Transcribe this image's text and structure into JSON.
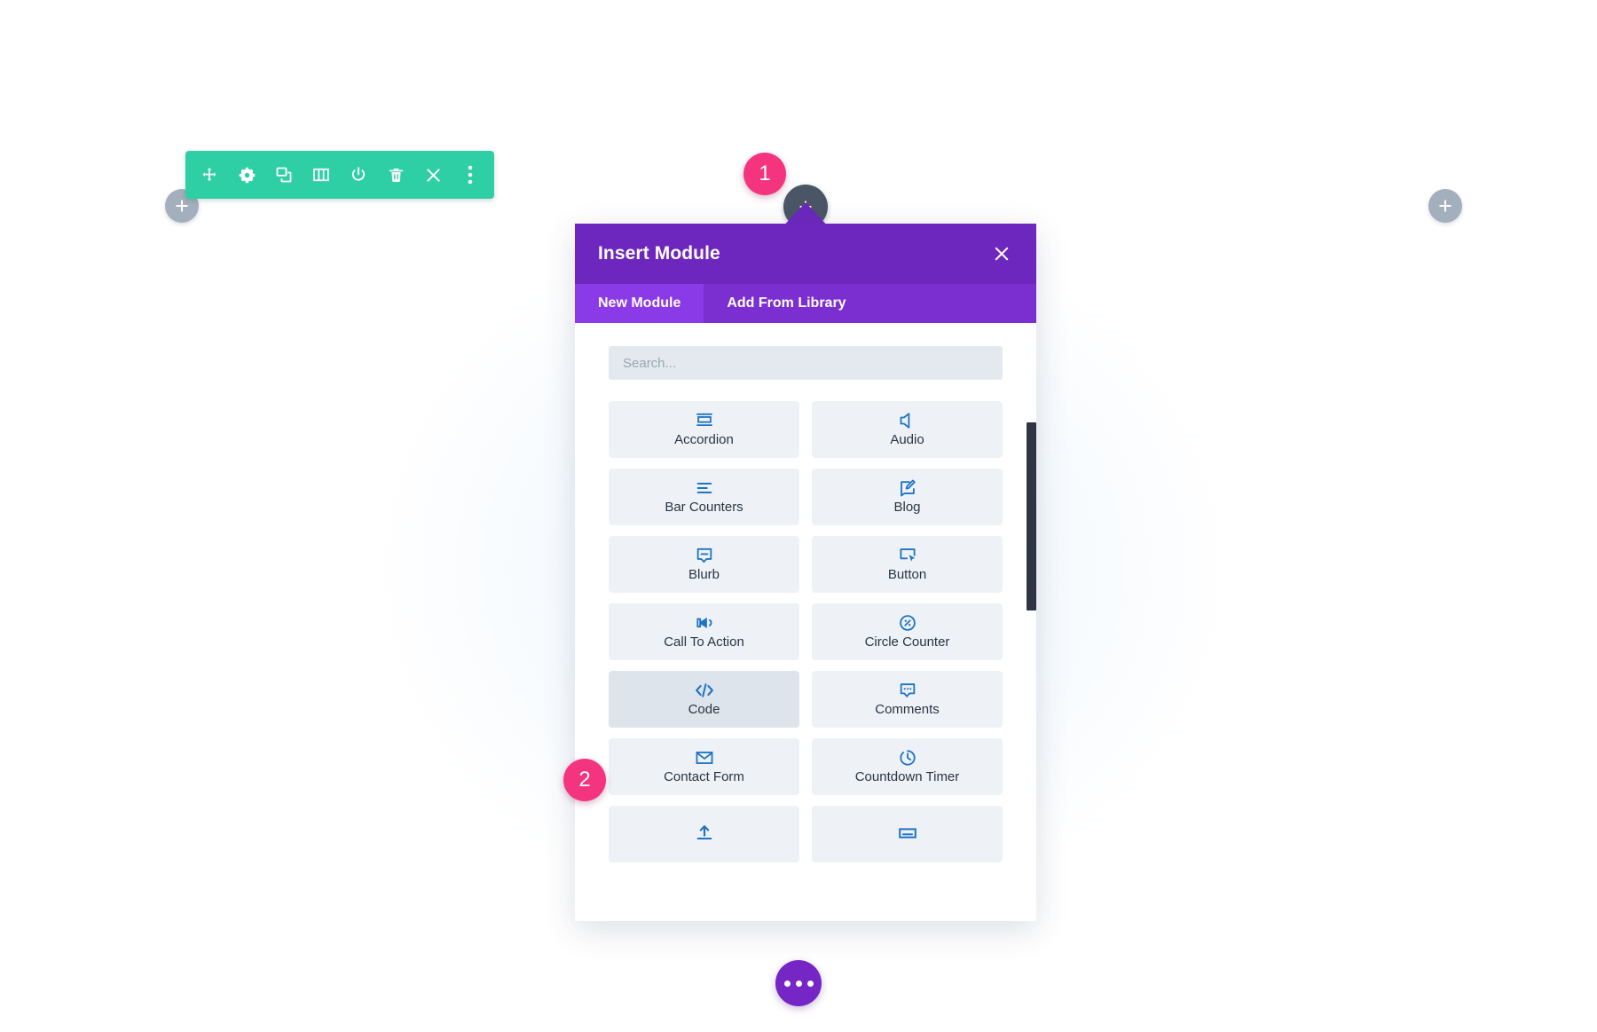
{
  "toolbar": {
    "name": "module-settings-toolbar",
    "color": "#2ecfa5",
    "buttons": [
      {
        "name": "move-handle-icon",
        "label": "Move"
      },
      {
        "name": "gear-icon",
        "label": "Settings"
      },
      {
        "name": "duplicate-icon",
        "label": "Duplicate"
      },
      {
        "name": "columns-icon",
        "label": "Columns"
      },
      {
        "name": "power-icon",
        "label": "Disable"
      },
      {
        "name": "trash-icon",
        "label": "Delete"
      },
      {
        "name": "close-icon",
        "label": "Close"
      },
      {
        "name": "more-vertical-icon",
        "label": "More Options"
      }
    ]
  },
  "add_buttons": {
    "left_label": "+",
    "right_label": "+",
    "insert_label": "+",
    "color": "#a3afbd"
  },
  "steps": [
    {
      "number": "1",
      "color": "#f4347f"
    },
    {
      "number": "2",
      "color": "#f4347f"
    }
  ],
  "modal": {
    "title": "Insert Module",
    "close_label": "✕",
    "header_color": "#6d27be",
    "tabs": [
      {
        "label": "New Module",
        "active": true
      },
      {
        "label": "Add From Library",
        "active": false
      }
    ],
    "search": {
      "value": "",
      "placeholder": "Search..."
    },
    "modules": [
      {
        "label": "Accordion",
        "icon": "accordion-icon",
        "highlight": false
      },
      {
        "label": "Audio",
        "icon": "audio-speaker-icon",
        "highlight": false
      },
      {
        "label": "Bar Counters",
        "icon": "bar-counters-icon",
        "highlight": false
      },
      {
        "label": "Blog",
        "icon": "blog-edit-icon",
        "highlight": false
      },
      {
        "label": "Blurb",
        "icon": "blurb-bubble-icon",
        "highlight": false
      },
      {
        "label": "Button",
        "icon": "button-cursor-icon",
        "highlight": false
      },
      {
        "label": "Call To Action",
        "icon": "megaphone-icon",
        "highlight": false
      },
      {
        "label": "Circle Counter",
        "icon": "circle-percent-icon",
        "highlight": false
      },
      {
        "label": "Code",
        "icon": "code-brackets-icon",
        "highlight": true
      },
      {
        "label": "Comments",
        "icon": "comments-icon",
        "highlight": false
      },
      {
        "label": "Contact Form",
        "icon": "envelope-icon",
        "highlight": false
      },
      {
        "label": "Countdown Timer",
        "icon": "clock-icon",
        "highlight": false
      },
      {
        "label": "",
        "icon": "upload-arrow-icon",
        "highlight": false
      },
      {
        "label": "",
        "icon": "fullwidth-header-icon",
        "highlight": false
      }
    ]
  },
  "footer": {
    "ellipsis_name": "page-settings-ellipsis-button",
    "color": "#7526c4"
  }
}
